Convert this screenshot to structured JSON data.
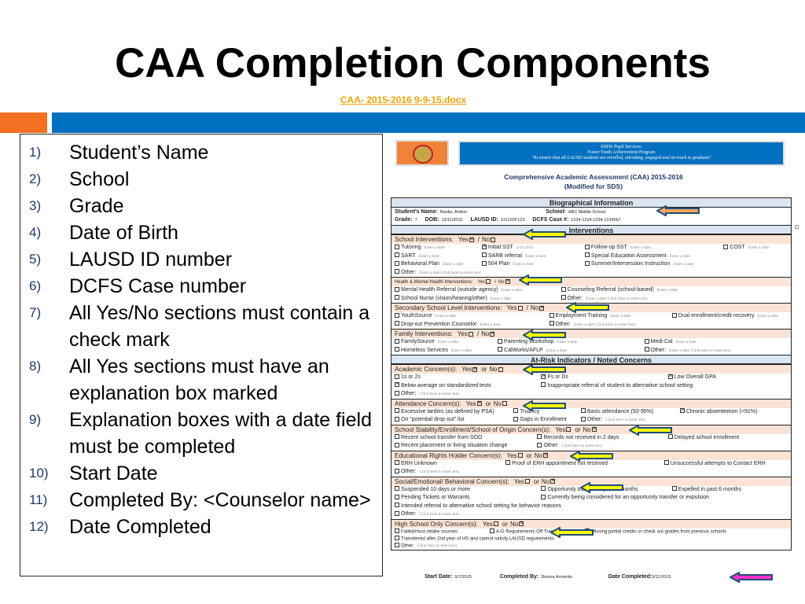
{
  "slide": {
    "title": "CAA Completion Components",
    "link": "CAA- 2015-2016 9-9-15.docx"
  },
  "colors": {
    "orange_bar": "#f36f21",
    "blue_bar": "#0070c0",
    "link": "#f0a30a",
    "arrow_yellow": "#ffff00",
    "arrow_orange": "#f4a460",
    "arrow_magenta": "#ff33cc",
    "arrow_outline": "#1f4e79"
  },
  "list": [
    {
      "num": "1)",
      "text": "Student’s Name"
    },
    {
      "num": "2)",
      "text": "School"
    },
    {
      "num": "3)",
      "text": "Grade"
    },
    {
      "num": "4)",
      "text": "Date of Birth"
    },
    {
      "num": "5)",
      "text": "LAUSD ID number"
    },
    {
      "num": "6)",
      "text": "DCFS Case number"
    },
    {
      "num": "7)",
      "text": "All Yes/No sections must contain a check mark"
    },
    {
      "num": "8)",
      "text": "All Yes sections must have an explanation box marked"
    },
    {
      "num": "9)",
      "text": "Explanation boxes with a date field must be completed"
    },
    {
      "num": "10)",
      "text": "Start Date"
    },
    {
      "num": "11)",
      "text": "Completed By: <Counselor name>"
    },
    {
      "num": "12)",
      "text": "Date Completed"
    }
  ],
  "form": {
    "banner": {
      "line1": "SHHS Pupil Services:",
      "line2": "Foster Youth Achievement Program",
      "line3": "\"To ensure that all LAUSD students are enrolled, attending, engaged and on-track to graduate\""
    },
    "title": "Comprehensive Academic Assessment (CAA) 2015-2016",
    "subtitle": "(Modified for SDS)",
    "bio": {
      "header": "Biographical Information",
      "name_label": "Student’s Name:",
      "name": "Banks, Amber",
      "school_label": "School:",
      "school": "ABC Middle School",
      "grade_label": "Grade:",
      "grade": "7",
      "dob_label": "DOB:",
      "dob": "12/11/2010",
      "id_label": "LAUSD ID:",
      "id": "121102F123",
      "dcfs_label": "DCFS Case #:",
      "dcfs": "1234-1234-1234-1234567"
    },
    "groups": [
      {
        "header": "Interventions",
        "sections": [
          {
            "title": "School Interventions:",
            "yes_no": [
              "Yes",
              "/",
              "No"
            ],
            "yes": true,
            "no": false,
            "cols": "22% 26% 35% 17%",
            "rows": [
              [
                {
                  "label": "Tutoring",
                  "checked": false,
                  "note": "Enter a date"
                },
                {
                  "label": "Initial SST",
                  "checked": true,
                  "note": "3/21/2015"
                },
                {
                  "label": "Follow-up SST",
                  "checked": false,
                  "note": "Enter a date"
                },
                {
                  "label": "COST",
                  "checked": false,
                  "note": "Enter a date"
                }
              ],
              [
                {
                  "label": "SART",
                  "checked": false,
                  "note": "Enter a date"
                },
                {
                  "label": "SARB referral",
                  "checked": false,
                  "note": "Enter a date"
                },
                {
                  "label": "Special Education Assessment",
                  "checked": false,
                  "note": "Enter a date"
                }
              ],
              [
                {
                  "label": "Behavioral Plan",
                  "checked": false,
                  "note": "Enter a date"
                },
                {
                  "label": "504 Plan",
                  "checked": false,
                  "note": "Enter a date"
                },
                {
                  "label": "Summer/Intersession Instruction",
                  "checked": false,
                  "note": "Enter a date"
                }
              ],
              [
                {
                  "label": "Other:",
                  "checked": false,
                  "note": "Enter a date    Click here to enter text."
                }
              ]
            ]
          },
          {
            "title": "Health & Mental Health Interventions:",
            "small": true,
            "yes_no": [
              "Yes",
              "/",
              "No"
            ],
            "yes": false,
            "no": true,
            "cols": "42% 58%",
            "rows": [
              [
                {
                  "label": "Mental Health Referral (outside agency)",
                  "checked": false,
                  "note": "Enter a date"
                },
                {
                  "label": "Counseling Referral (school-based)",
                  "checked": false,
                  "note": "Enter a date"
                }
              ],
              [
                {
                  "label": "School Nurse (vision/hearing/other)",
                  "checked": false,
                  "note": "Enter a date"
                },
                {
                  "label": "Other:",
                  "checked": false,
                  "note": "Enter a date    Click here to enter text."
                }
              ]
            ]
          },
          {
            "title": "Secondary School Level Interventions:",
            "yes_no": [
              "Yes",
              "/",
              "No"
            ],
            "yes": false,
            "no": true,
            "cols": "39% 31% 30%",
            "rows": [
              [
                {
                  "label": "YouthSource",
                  "checked": false,
                  "note": "Enter a date"
                },
                {
                  "label": "Employment Training",
                  "checked": false,
                  "note": "Enter a date"
                },
                {
                  "label": "Dual enrollment/credit recovery",
                  "checked": false,
                  "note": "Enter a date"
                }
              ],
              [
                {
                  "label": "Drop-out Prevention Counselor",
                  "checked": false,
                  "note": "Enter a date"
                },
                {
                  "label": "Other:",
                  "checked": false,
                  "note": "Enter a date    Click here to enter text."
                }
              ]
            ]
          },
          {
            "title": "Family Interventions:",
            "yes_no": [
              "Yes",
              "/",
              "No"
            ],
            "yes": false,
            "no": true,
            "cols": "26% 37% 37%",
            "rows": [
              [
                {
                  "label": "FamilySource",
                  "checked": false,
                  "note": "Enter a date"
                },
                {
                  "label": "Parenting Workshop",
                  "checked": false,
                  "note": "Enter a date"
                },
                {
                  "label": "Medi-Cal",
                  "checked": false,
                  "note": "Enter a date"
                }
              ],
              [
                {
                  "label": "Homeless Services",
                  "checked": false,
                  "note": "Enter a date"
                },
                {
                  "label": "CalWorks/AFLP",
                  "checked": false,
                  "note": "Enter a date"
                },
                {
                  "label": "Other:",
                  "checked": false,
                  "note": "Enter a date    Click here to enter text."
                }
              ]
            ]
          }
        ]
      },
      {
        "header": "At-Risk Indicators / Noted Concerns",
        "sections": [
          {
            "title": "Academic Concern(s):",
            "yes_no": [
              "Yes",
              "or",
              "No"
            ],
            "yes": true,
            "no": false,
            "cols": "37% 32% 31%",
            "rows": [
              [
                {
                  "label": "1s or 2s",
                  "checked": false
                },
                {
                  "label": "Fs or Ds",
                  "checked": true
                },
                {
                  "label": "Low Overall GPA",
                  "checked": true
                }
              ],
              [
                {
                  "label": "Below average on standardized tests",
                  "checked": true
                },
                {
                  "label": "Inappropriate referral of student to alternative school setting",
                  "checked": false
                }
              ],
              [
                {
                  "label": "Other:",
                  "checked": false,
                  "note": "Click here to enter text."
                }
              ]
            ]
          },
          {
            "title": "Attendance Concern(s):",
            "yes_no": [
              "Yes",
              "or",
              "No"
            ],
            "yes": true,
            "no": false,
            "cols": "30% 17% 25% 28%",
            "rows": [
              [
                {
                  "label": "Excessive tardies (as defined by PSA)",
                  "checked": false
                },
                {
                  "label": "Truancy",
                  "checked": false
                },
                {
                  "label": "Basic attendance (92-95%)",
                  "checked": false
                },
                {
                  "label": "Chronic absenteeism (<91%)",
                  "checked": true
                }
              ],
              [
                {
                  "label": "On “potential drop out” list",
                  "checked": false
                },
                {
                  "label": "Gaps in Enrollment",
                  "checked": false
                },
                {
                  "label": "Other:",
                  "checked": false,
                  "note": "Click here to enter text."
                }
              ]
            ]
          },
          {
            "title": "School Stability/Enrollment/School of Origin Concern(s):",
            "yes_no": [
              "Yes",
              "or",
              "No"
            ],
            "yes": false,
            "no": true,
            "cols": "36% 33% 31%",
            "rows": [
              [
                {
                  "label": "Recent school transfer from SOO",
                  "checked": false
                },
                {
                  "label": "Records not received in 2 days",
                  "checked": false
                },
                {
                  "label": "Delayed school enrollment",
                  "checked": false
                }
              ],
              [
                {
                  "label": "Recent placement or living situation change",
                  "checked": false
                },
                {
                  "label": "Other:",
                  "checked": false,
                  "note": "Click here to enter text."
                }
              ]
            ]
          },
          {
            "title": "Educational Rights Holder Concern(s):",
            "yes_no": [
              "Yes",
              "or",
              "No"
            ],
            "yes": false,
            "no": true,
            "cols": "28% 40% 32%",
            "rows": [
              [
                {
                  "label": "ERH Unknown",
                  "checked": false
                },
                {
                  "label": "Proof of ERH appointment not received",
                  "checked": false
                },
                {
                  "label": "Unsuccessful attempts to Contact ERH",
                  "checked": false
                }
              ],
              [
                {
                  "label": "Other:",
                  "checked": false,
                  "note": "Click here to enter text."
                }
              ]
            ]
          },
          {
            "title": "Social/Emotional/ Behavioral Concern(s):",
            "yes_no": [
              "Yes",
              "or",
              "No"
            ],
            "yes": false,
            "no": true,
            "cols": "37% 33% 30%",
            "rows": [
              [
                {
                  "label": "Suspended 10 days or more",
                  "checked": false
                },
                {
                  "label": "Opportunity transfer in past 6 months",
                  "checked": false
                },
                {
                  "label": "Expelled in past 6 months",
                  "checked": false
                }
              ],
              [
                {
                  "label": "Pending Tickets or Warrants",
                  "checked": false
                },
                {
                  "label": "Currently being considered for an opportunity transfer or expulsion",
                  "checked": false
                }
              ],
              [
                {
                  "label": "Intended referral to alternative school setting for behavior reasons",
                  "checked": false
                }
              ],
              [
                {
                  "label": "Other:",
                  "checked": false,
                  "note": "Click here to enter text."
                }
              ]
            ]
          },
          {
            "title": "High School Only Concern(s):",
            "yes_no": [
              "Yes",
              "or",
              "No"
            ],
            "yes": false,
            "no": true,
            "small_rows": true,
            "cols": "24% 24% 52%",
            "rows": [
              [
                {
                  "label": "Failed/must retake courses",
                  "checked": false
                },
                {
                  "label": "A-G Requirements Off Track",
                  "checked": false
                },
                {
                  "label": "Missing partial credits or check out grades from previous schools",
                  "checked": false
                }
              ],
              [
                {
                  "label": "Transferred after 2nd year of HS and cannot satisfy LAUSD requirements.",
                  "checked": false
                }
              ],
              [
                {
                  "label": "Other:",
                  "checked": false,
                  "note": "Click here to enter text."
                }
              ]
            ]
          }
        ]
      }
    ],
    "footer": {
      "start_label": "Start Date:",
      "start": "9/7/2015",
      "by_label": "Completed By:",
      "by": "Dianna Armenta",
      "completed_label": "Date Completed:",
      "completed": "9/11/2015"
    }
  }
}
